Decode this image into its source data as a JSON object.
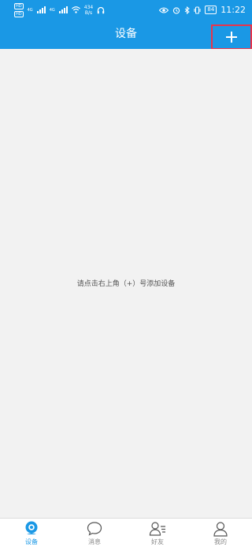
{
  "status_bar": {
    "sim1": "HD",
    "sim2": "HD",
    "net1": "4G",
    "net2": "4G",
    "speed_value": "434",
    "speed_unit": "B/s",
    "battery": "84",
    "time": "11:22"
  },
  "header": {
    "title": "设备",
    "add_icon": "plus-icon"
  },
  "main": {
    "empty_hint": "请点击右上角（+）号添加设备"
  },
  "tabs": [
    {
      "label": "设备",
      "icon": "camera-icon",
      "active": true
    },
    {
      "label": "消息",
      "icon": "chat-bubble-icon",
      "active": false
    },
    {
      "label": "好友",
      "icon": "friends-icon",
      "active": false
    },
    {
      "label": "我的",
      "icon": "person-icon",
      "active": false
    }
  ],
  "colors": {
    "primary": "#1a98e5",
    "highlight_border": "#e8334a",
    "background": "#f2f2f2",
    "inactive_tab": "#888888"
  }
}
